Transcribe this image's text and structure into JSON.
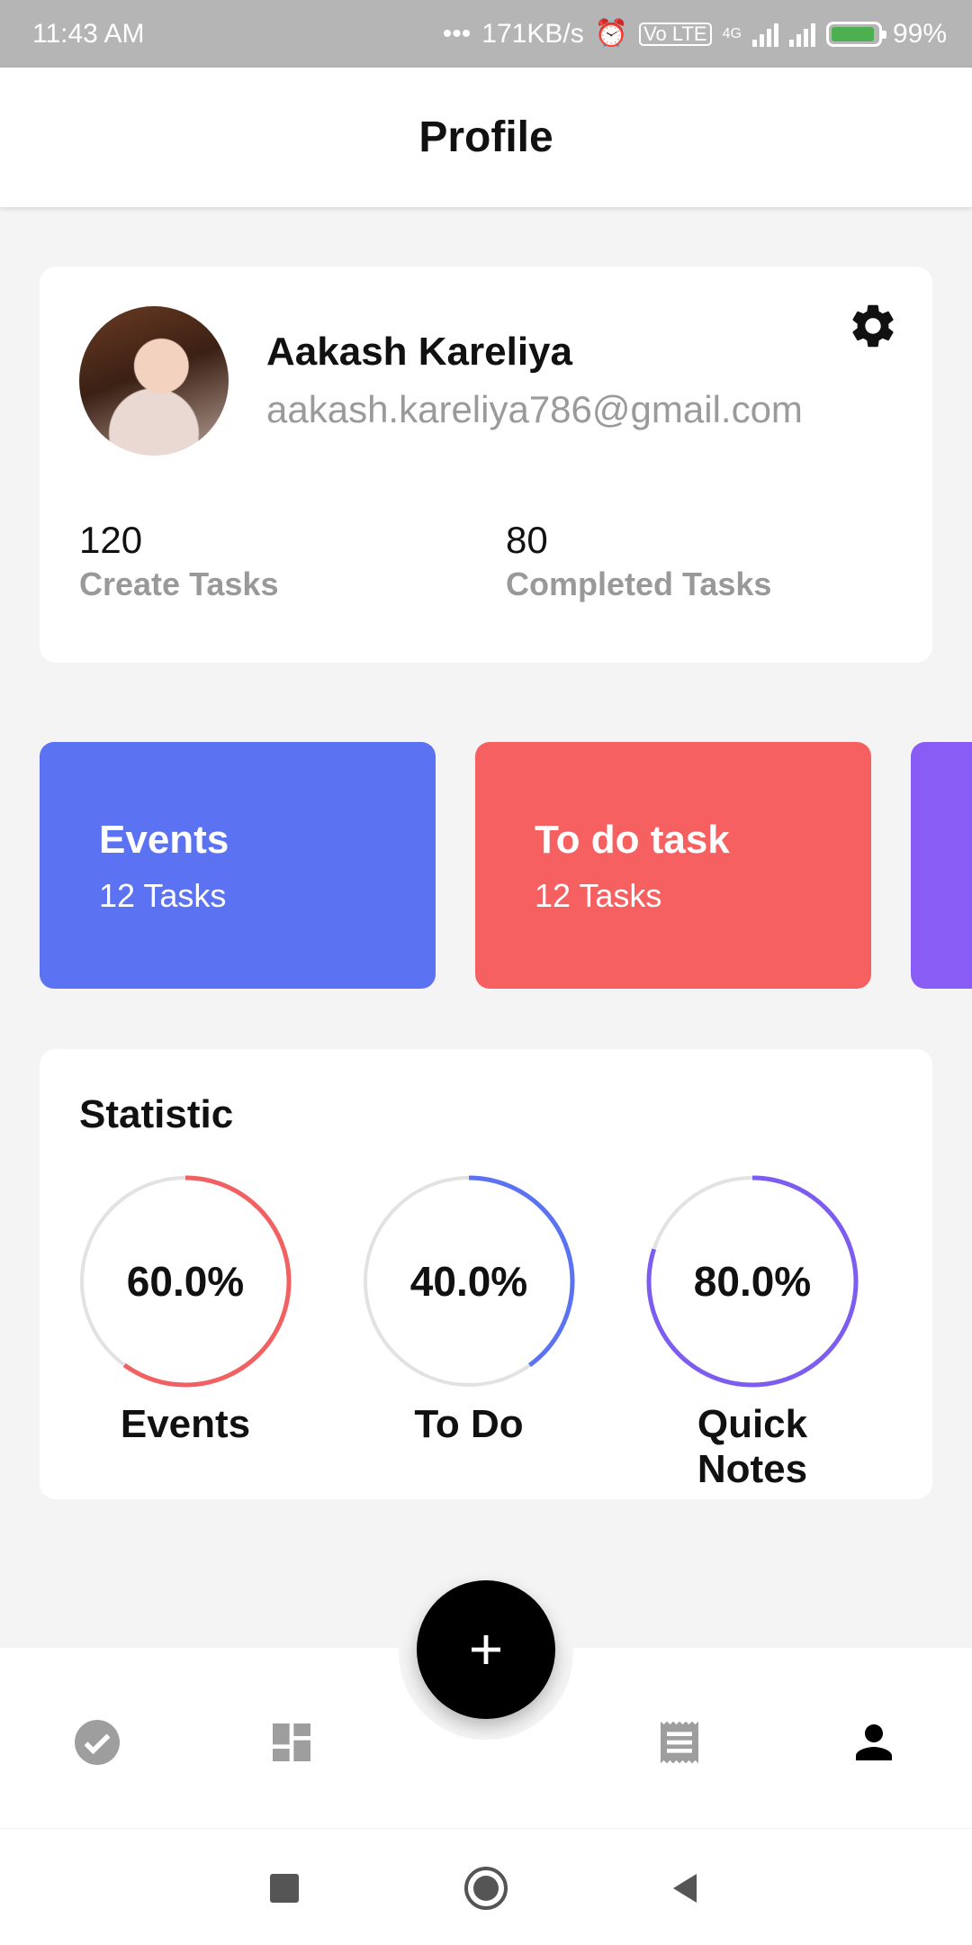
{
  "status_bar": {
    "time": "11:43 AM",
    "net_speed": "171KB/s",
    "volte_label": "Vo LTE",
    "network_label": "4G",
    "battery": "99%"
  },
  "header": {
    "title": "Profile"
  },
  "profile": {
    "name": "Aakash Kareliya",
    "email": "aakash.kareliya786@gmail.com",
    "stats": [
      {
        "value": "120",
        "label": "Create Tasks"
      },
      {
        "value": "80",
        "label": "Completed Tasks"
      }
    ],
    "settings_icon": "gear-icon"
  },
  "tiles": [
    {
      "title": "Events",
      "subtitle": "12 Tasks",
      "color": "#5b73f3"
    },
    {
      "title": "To do task",
      "subtitle": "12 Tasks",
      "color": "#f76060"
    },
    {
      "title": "",
      "subtitle": "",
      "color": "#8a5cf6"
    }
  ],
  "statistic": {
    "title": "Statistic",
    "items": [
      {
        "label": "Events",
        "percent_text": "60.0%",
        "value": 0.6,
        "color": "#f26162"
      },
      {
        "label": "To Do",
        "percent_text": "40.0%",
        "value": 0.4,
        "color": "#5b73f3"
      },
      {
        "label": "Quick Notes",
        "percent_text": "80.0%",
        "value": 0.8,
        "color": "#7d5cf0"
      }
    ],
    "track_color": "#e2e2e2"
  },
  "bottom_nav": {
    "items": [
      {
        "icon": "check-circle-icon",
        "active": false
      },
      {
        "icon": "dashboard-icon",
        "active": false
      },
      {
        "icon": "receipt-icon",
        "active": false
      },
      {
        "icon": "person-icon",
        "active": true
      }
    ],
    "fab_icon": "plus-icon"
  },
  "system_nav": [
    "square-icon",
    "home-circle-icon",
    "back-triangle-icon"
  ]
}
